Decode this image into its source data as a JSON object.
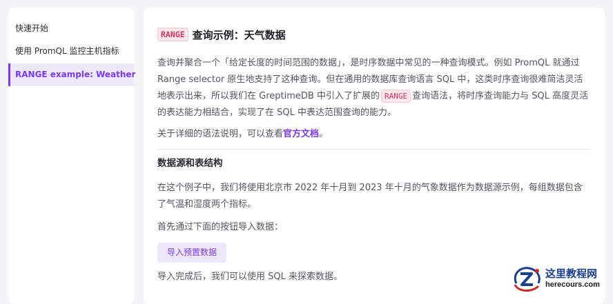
{
  "sidebar": {
    "items": [
      {
        "label": "快速开始"
      },
      {
        "label": "使用 PromQL 监控主机指标"
      },
      {
        "label": "RANGE example: Weather"
      }
    ]
  },
  "main": {
    "title": {
      "code": "RANGE",
      "text": "查询示例：天气数据"
    },
    "intro": {
      "part1": "查询并聚合一个「给定长度的时间范围的数据」，是时序数据中常见的一种查询模式。例如 PromQL 就通过 Range selector 原生地支持了这种查询。但在通用的数据库查询语言 SQL 中，这类时序查询很难简洁灵活地表示出来，所以我们在 GreptimeDB 中引入了扩展的",
      "code": "RANGE",
      "part2": "查询语法，将时序查询能力与 SQL 高度灵活的表达能力相结合，实现了在 SQL 中表达范围查询的能力。"
    },
    "docs_line": {
      "prefix": "关于详细的语法说明，可以查看",
      "link": "官方文档",
      "suffix": "。"
    },
    "section_title": "数据源和表结构",
    "dataset_text": "在这个例子中，我们将使用北京市 2022 年十月到 2023 年十月的气象数据作为数据源示例，每组数据包含了气温和湿度两个指标。",
    "import_hint": "首先通过下面的按钮导入数据：",
    "import_button": "导入预置数据",
    "after_import": "导入完成后，我们可以使用 SQL 来探索数据。"
  },
  "watermark": {
    "title": "这里教程网",
    "sub": "herecours.com"
  },
  "colors": {
    "accent": "#7c3aed",
    "code_text": "#d6335e",
    "code_bg": "#fbe6ec"
  }
}
